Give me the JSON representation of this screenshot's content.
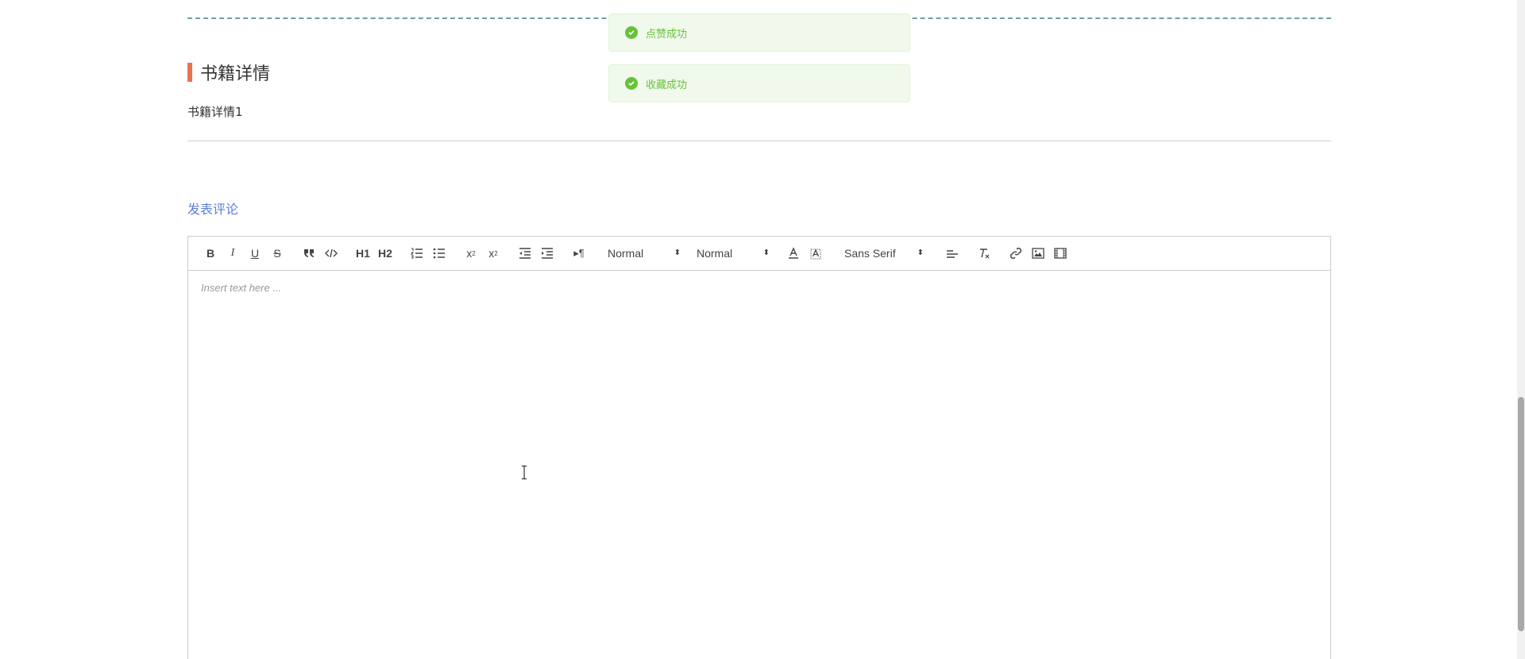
{
  "section": {
    "title": "书籍详情",
    "detail": "书籍详情1"
  },
  "comment": {
    "link_label": "发表评论"
  },
  "editor": {
    "toolbar": {
      "header_select": "Normal",
      "size_select": "Normal",
      "font_select": "Sans Serif",
      "h1_label": "H1",
      "h2_label": "H2"
    },
    "placeholder": "Insert text here ..."
  },
  "toasts": [
    {
      "message": "点赞成功"
    },
    {
      "message": "收藏成功"
    }
  ],
  "colors": {
    "accent_bar": "#e8734f",
    "link": "#5b7fd6",
    "success": "#67c23a"
  }
}
